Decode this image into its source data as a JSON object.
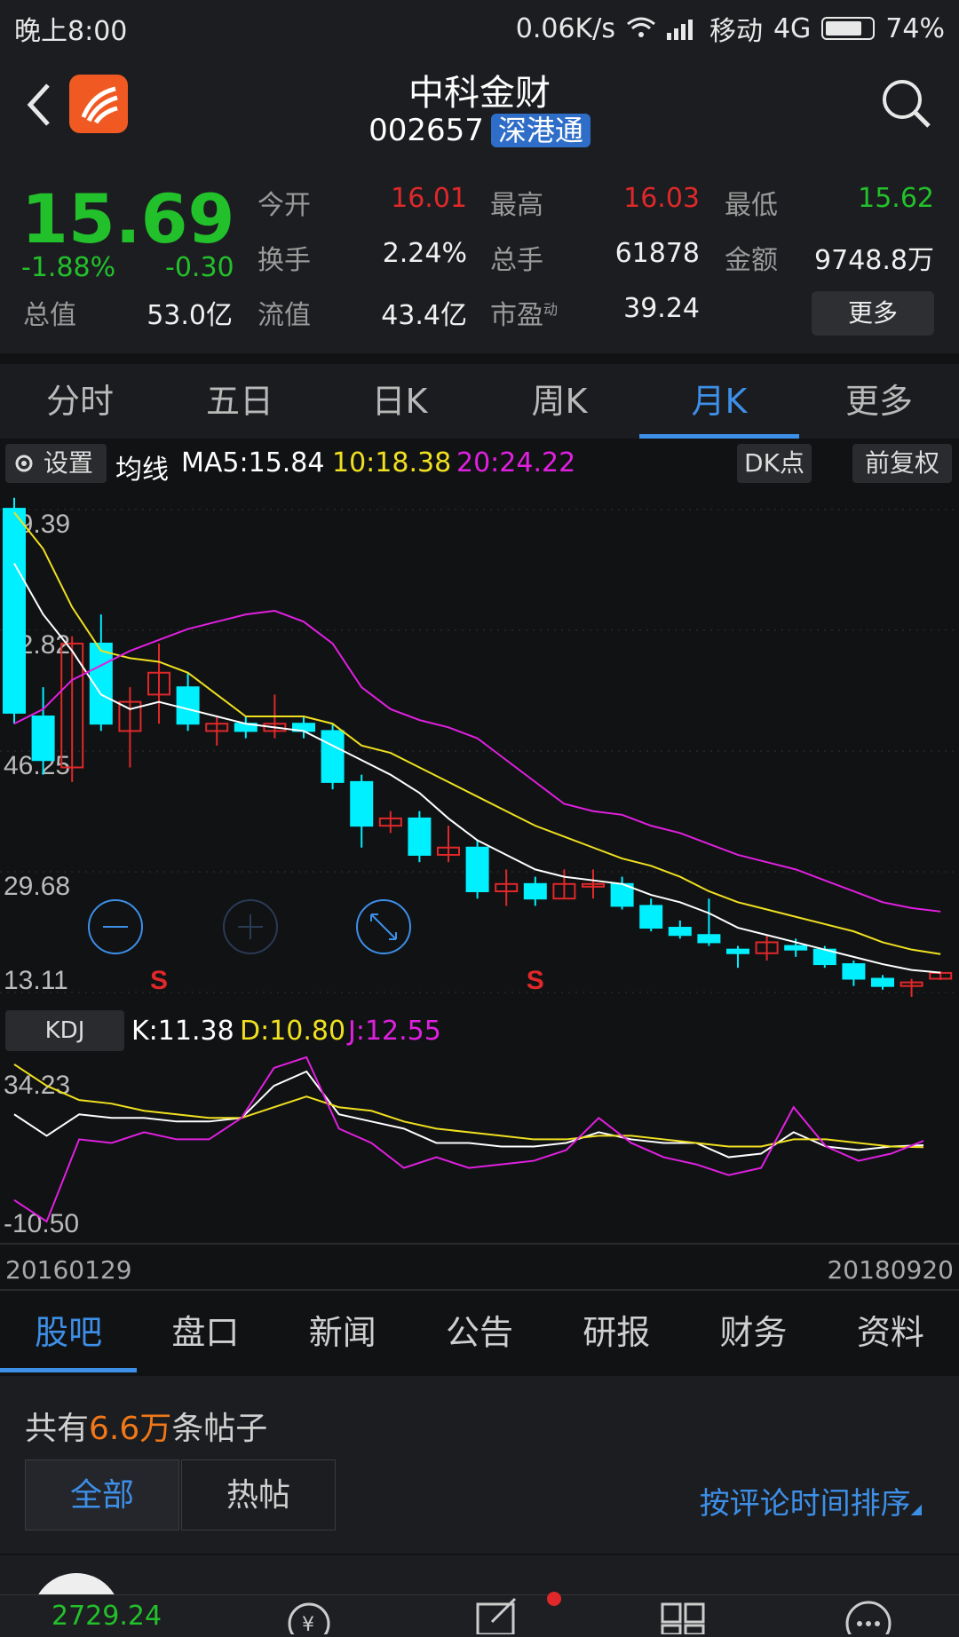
{
  "status_bar": {
    "time": "晚上8:00",
    "net_speed": "0.06K/s",
    "carrier": "移动",
    "network": "4G",
    "battery": "74%",
    "battery_level": 0.74
  },
  "header": {
    "name": "中科金财",
    "code": "002657",
    "tag": "深港通"
  },
  "quote": {
    "price": "15.69",
    "change_pct": "-1.88%",
    "change": "-0.30",
    "rows": [
      {
        "label": "今开",
        "value": "16.01",
        "color": "red"
      },
      {
        "label": "最高",
        "value": "16.03",
        "color": "red"
      },
      {
        "label": "最低",
        "value": "15.62",
        "color": "green"
      },
      {
        "label": "换手",
        "value": "2.24%",
        "color": "white"
      },
      {
        "label": "总手",
        "value": "61878",
        "color": "white"
      },
      {
        "label": "金额",
        "value": "9748.8万",
        "color": "white"
      }
    ],
    "total_value_label": "总值",
    "total_value": "53.0亿",
    "float_value_label": "流值",
    "float_value": "43.4亿",
    "pe_label": "市盈",
    "pe_sup": "动",
    "pe": "39.24",
    "more": "更多"
  },
  "period_tabs": [
    "分时",
    "五日",
    "日K",
    "周K",
    "月K",
    "更多"
  ],
  "active_period": 4,
  "ma_bar": {
    "settings": "设置",
    "label": "均线",
    "ma5": "MA5:15.84",
    "ma10": "10:18.38",
    "ma20": "20:24.22",
    "dk": "DK点",
    "fq": "前复权"
  },
  "kdj_bar": {
    "button": "KDJ",
    "k": "K:11.38",
    "d": "D:10.80",
    "j": "J:12.55"
  },
  "dates": {
    "start": "20160129",
    "end": "20180920"
  },
  "bottom_tabs": [
    "股吧",
    "盘口",
    "新闻",
    "公告",
    "研报",
    "财务",
    "资料"
  ],
  "active_bottom": 0,
  "posts": {
    "prefix": "共有",
    "count": "6.6万",
    "suffix": "条帖子",
    "all": "全部",
    "hot": "热帖",
    "sort": "按评论时间排序"
  },
  "index_value": "2729.24",
  "colors": {
    "up": "#e0282a",
    "down": "#00f0ff",
    "ma5": "#ffffff",
    "ma10": "#f0e020",
    "ma20": "#e020e0",
    "accent": "#3d8fe8"
  },
  "chart_data": [
    {
      "type": "candlestick",
      "title": "月K",
      "y_ticks": [
        "79.39",
        "62.82",
        "46.25",
        "29.68",
        "13.11"
      ],
      "ylim": [
        13.11,
        79.39
      ],
      "markers": [
        {
          "index": 5,
          "label": "S"
        },
        {
          "index": 18,
          "label": "S"
        }
      ],
      "candles": [
        [
          79.5,
          51.5,
          81.0,
          50.0
        ],
        [
          51.0,
          45.0,
          55.0,
          43.0
        ],
        [
          44.0,
          61.0,
          62.0,
          42.0
        ],
        [
          61.0,
          50.0,
          65.0,
          49.0
        ],
        [
          49.0,
          53.0,
          55.0,
          44.0
        ],
        [
          54.0,
          57.0,
          61.0,
          50.0
        ],
        [
          55.0,
          50.0,
          57.0,
          49.0
        ],
        [
          49.0,
          50.0,
          51.0,
          47.0
        ],
        [
          50.0,
          49.0,
          51.0,
          48.0
        ],
        [
          49.0,
          50.0,
          54.0,
          48.0
        ],
        [
          50.0,
          49.0,
          51.0,
          48.0
        ],
        [
          49.0,
          42.0,
          50.0,
          41.0
        ],
        [
          42.0,
          36.0,
          43.0,
          33.0
        ],
        [
          36.0,
          37.0,
          38.0,
          35.0
        ],
        [
          37.0,
          32.0,
          38.0,
          31.0
        ],
        [
          32.0,
          33.0,
          36.0,
          31.0
        ],
        [
          33.0,
          27.0,
          34.0,
          26.0
        ],
        [
          27.0,
          28.0,
          30.0,
          25.0
        ],
        [
          28.0,
          26.0,
          29.0,
          25.0
        ],
        [
          26.0,
          28.0,
          30.0,
          26.0
        ],
        [
          28.0,
          28.0,
          30.0,
          26.0
        ],
        [
          28.0,
          25.0,
          29.0,
          24.5
        ],
        [
          25.0,
          22.0,
          26.0,
          21.5
        ],
        [
          22.0,
          21.0,
          23.0,
          20.5
        ],
        [
          21.0,
          20.0,
          26.0,
          19.5
        ],
        [
          19.0,
          18.5,
          19.5,
          16.5
        ],
        [
          18.5,
          20.0,
          21.0,
          17.5
        ],
        [
          19.5,
          19.0,
          20.5,
          18.0
        ],
        [
          19.0,
          17.0,
          19.5,
          16.5
        ],
        [
          17.0,
          15.0,
          17.5,
          14.0
        ],
        [
          15.0,
          14.0,
          15.5,
          13.5
        ],
        [
          14.0,
          14.5,
          15.0,
          12.5
        ],
        [
          15.0,
          15.8,
          16.0,
          14.8
        ]
      ],
      "ma5": [
        72.0,
        65.0,
        60.0,
        54.0,
        52.0,
        53.0,
        52.0,
        51.0,
        50.0,
        49.5,
        49.0,
        47.0,
        45.0,
        43.0,
        40.5,
        37.0,
        34.0,
        32.0,
        30.0,
        29.0,
        28.5,
        28.0,
        26.5,
        25.5,
        24.0,
        22.0,
        21.0,
        20.0,
        19.0,
        18.0,
        17.0,
        16.2,
        15.84
      ],
      "ma10": [
        79.0,
        74.0,
        66.0,
        60.0,
        59.0,
        58.5,
        57.0,
        54.0,
        51.0,
        51.0,
        51.0,
        50.0,
        47.0,
        46.0,
        44.0,
        42.0,
        40.0,
        38.0,
        36.0,
        34.5,
        33.0,
        31.5,
        30.5,
        29.0,
        27.0,
        25.5,
        24.5,
        23.5,
        22.5,
        21.5,
        20.0,
        19.0,
        18.38
      ],
      "ma20": [
        50.0,
        52.0,
        56.0,
        58.0,
        60.0,
        61.5,
        63.0,
        64.0,
        65.0,
        65.5,
        64.0,
        61.0,
        55.0,
        52.0,
        50.5,
        49.5,
        48.0,
        45.0,
        42.0,
        39.0,
        38.0,
        37.5,
        36.0,
        35.0,
        33.5,
        32.0,
        31.0,
        30.0,
        28.5,
        27.0,
        25.5,
        24.7,
        24.22
      ]
    },
    {
      "type": "line",
      "title": "KDJ",
      "y_ticks": [
        "34.23",
        "-10.50"
      ],
      "ylim": [
        -10.5,
        34.23
      ],
      "series": [
        {
          "name": "K",
          "values": [
            20,
            14,
            20,
            19,
            19,
            18,
            18,
            19,
            28,
            32,
            20,
            18,
            16,
            12,
            12,
            11,
            11,
            12,
            15,
            13,
            12,
            12,
            8,
            9,
            15,
            11,
            10,
            11,
            11.38
          ]
        },
        {
          "name": "D",
          "values": [
            34,
            28,
            24,
            23,
            21,
            20,
            19,
            19,
            22,
            25,
            22,
            21,
            18,
            16,
            15,
            14,
            13,
            13,
            14,
            14,
            13,
            12,
            11,
            11,
            13,
            13,
            12,
            11,
            10.8
          ]
        },
        {
          "name": "J",
          "values": [
            -4,
            -10,
            13,
            12,
            15,
            13,
            13,
            19,
            33,
            36,
            16,
            12,
            5,
            8,
            5,
            6,
            7,
            10,
            19,
            12,
            8,
            6,
            3,
            5,
            22,
            11,
            7,
            9,
            12.55
          ]
        }
      ]
    }
  ]
}
